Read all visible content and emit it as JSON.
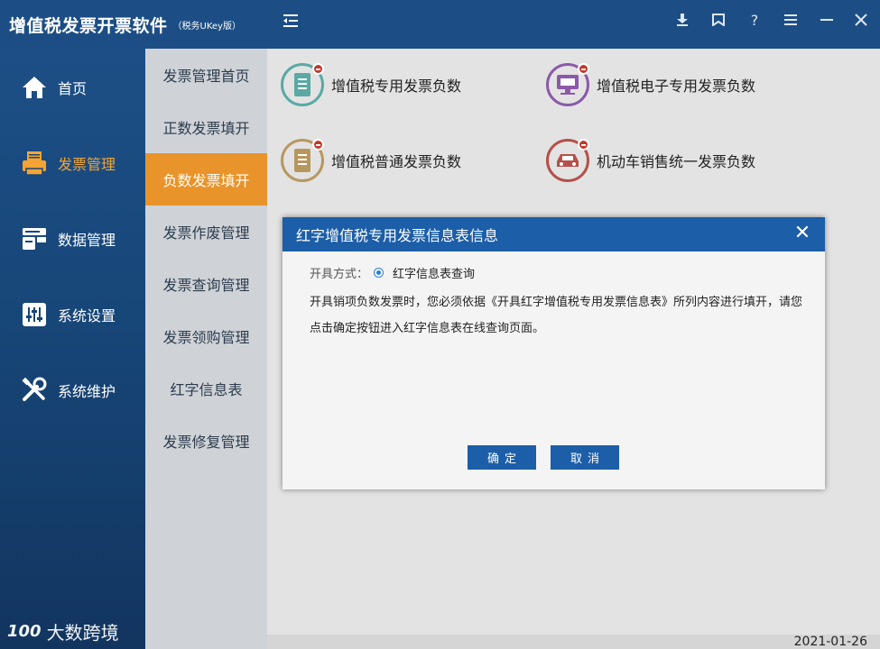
{
  "app": {
    "title": "增值税发票开票软件",
    "subtitle": "（税务UKey版）"
  },
  "nav": {
    "items": [
      {
        "label": "首页",
        "icon": "home-icon"
      },
      {
        "label": "发票管理",
        "icon": "printer-icon",
        "active": true
      },
      {
        "label": "数据管理",
        "icon": "data-icon"
      },
      {
        "label": "系统设置",
        "icon": "sliders-icon"
      },
      {
        "label": "系统维护",
        "icon": "tools-icon"
      }
    ]
  },
  "subnav": {
    "items": [
      {
        "label": "发票管理首页"
      },
      {
        "label": "正数发票填开"
      },
      {
        "label": "负数发票填开",
        "active": true
      },
      {
        "label": "发票作废管理"
      },
      {
        "label": "发票查询管理"
      },
      {
        "label": "发票领购管理"
      },
      {
        "label": "红字信息表"
      },
      {
        "label": "发票修复管理"
      }
    ]
  },
  "topbar": {
    "icons": [
      "menu-collapse-icon",
      "download-icon",
      "bookmark-icon",
      "help-icon",
      "hamburger-icon",
      "minimize-icon",
      "close-icon"
    ],
    "help_glyph": "?"
  },
  "tiles": [
    {
      "label": "增值税专用发票负数",
      "color": "#5aa9a4",
      "icon": "special-invoice-icon"
    },
    {
      "label": "增值税电子专用发票负数",
      "color": "#8b5aa8",
      "icon": "e-invoice-icon"
    },
    {
      "label": "增值税普通发票负数",
      "color": "#b8975e",
      "icon": "normal-invoice-icon"
    },
    {
      "label": "机动车销售统一发票负数",
      "color": "#b5504a",
      "icon": "vehicle-icon"
    }
  ],
  "dialog": {
    "title": "红字增值税专用发票信息表信息",
    "method_label": "开具方式：",
    "method_option": "红字信息表查询",
    "message": "开具销项负数发票时，您必须依据《开具红字增值税专用发票信息表》所列内容进行填开，请您点击确定按钮进入红字信息表在线查询页面。",
    "ok_label": "确定",
    "cancel_label": "取消",
    "close_glyph": "✕"
  },
  "watermark": {
    "logo": "100",
    "text": "大数跨境"
  },
  "status": {
    "date": "2021-01-26"
  }
}
